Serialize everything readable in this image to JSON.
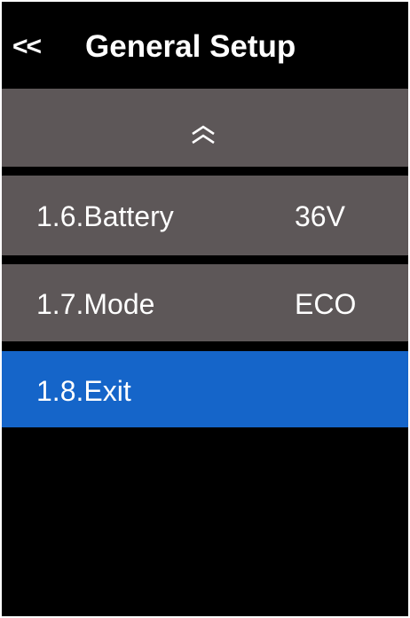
{
  "header": {
    "back_label": "<<",
    "title": "General Setup"
  },
  "menu": {
    "scroll_up_icon": "double-chevron-up-icon",
    "items": [
      {
        "label": "1.6.Battery",
        "value": "36V"
      },
      {
        "label": "1.7.Mode",
        "value": "ECO"
      },
      {
        "label": "1.8.Exit",
        "value": ""
      }
    ],
    "selected_index": 2
  },
  "colors": {
    "background": "#000000",
    "row": "#5d5758",
    "selected_row": "#1565c9",
    "text": "#ffffff"
  }
}
